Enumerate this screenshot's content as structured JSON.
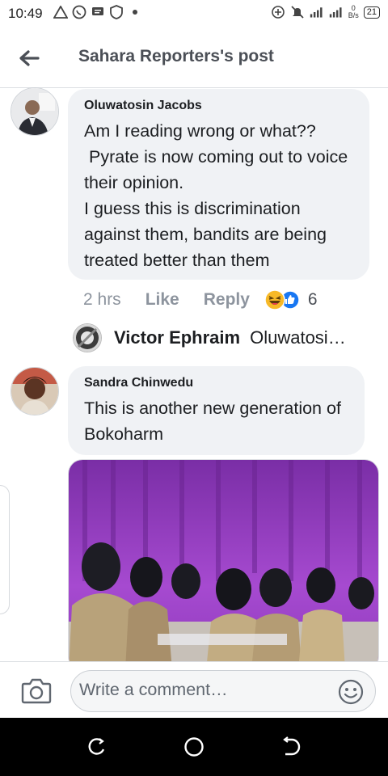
{
  "status_bar": {
    "time": "10:49",
    "net_speed_value": "0",
    "net_speed_unit": "B/s",
    "battery": "21"
  },
  "header": {
    "title": "Sahara Reporters's post"
  },
  "comments": [
    {
      "author": "Oluwatosin Jacobs",
      "text": "Am I reading wrong or what??\n Pyrate is now coming out to voice their opinion.\nI guess this is discrimination against them, bandits are being treated better than them",
      "time": "2 hrs",
      "like_label": "Like",
      "reply_label": "Reply",
      "reaction_count": "6",
      "reactions": [
        "haha-icon",
        "like-icon"
      ],
      "reply_preview": {
        "author": "Victor Ephraim",
        "text": "Oluwatosin Jacobs"
      }
    },
    {
      "author": "Sandra Chinwedu",
      "text": "This is another new generation of Bokoharm"
    }
  ],
  "composer": {
    "placeholder": "Write a comment…"
  },
  "colors": {
    "bubble": "#f0f2f5",
    "meta_text": "#8d949e",
    "haha": "#f7b928",
    "like": "#1877f2",
    "image_purple": "#9b3fbf"
  }
}
